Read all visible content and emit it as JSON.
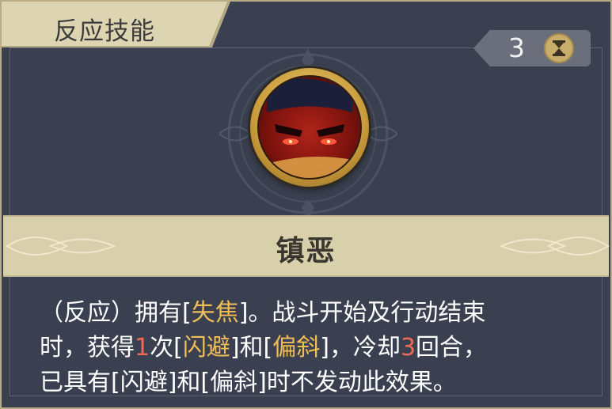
{
  "header": {
    "category_title": "反应技能"
  },
  "cooldown": {
    "value": "3",
    "icon": "hourglass-icon"
  },
  "skill": {
    "portrait_icon": "red-masked-hero-portrait",
    "name": "镇恶"
  },
  "description": {
    "line1": [
      {
        "text": "（反应）拥有[",
        "style": "plain"
      },
      {
        "text": "失焦",
        "style": "kw"
      },
      {
        "text": "]。战斗开始及行动结束",
        "style": "plain"
      }
    ],
    "line2": [
      {
        "text": "时，获得",
        "style": "plain"
      },
      {
        "text": "1",
        "style": "num"
      },
      {
        "text": "次[",
        "style": "plain"
      },
      {
        "text": "闪避",
        "style": "kw"
      },
      {
        "text": "]和[",
        "style": "plain"
      },
      {
        "text": "偏斜",
        "style": "kw"
      },
      {
        "text": "]，冷却",
        "style": "plain"
      },
      {
        "text": "3",
        "style": "num"
      },
      {
        "text": "回合，",
        "style": "plain"
      }
    ],
    "line3": [
      {
        "text": "已具有[闪避]和[偏斜]时不发动此效果。",
        "style": "plain"
      }
    ]
  },
  "colors": {
    "background": "#3b4050",
    "accent_gold": "#d8cfab",
    "keyword": "#f0bd57",
    "number": "#ee6a55",
    "text": "#ffffff"
  }
}
